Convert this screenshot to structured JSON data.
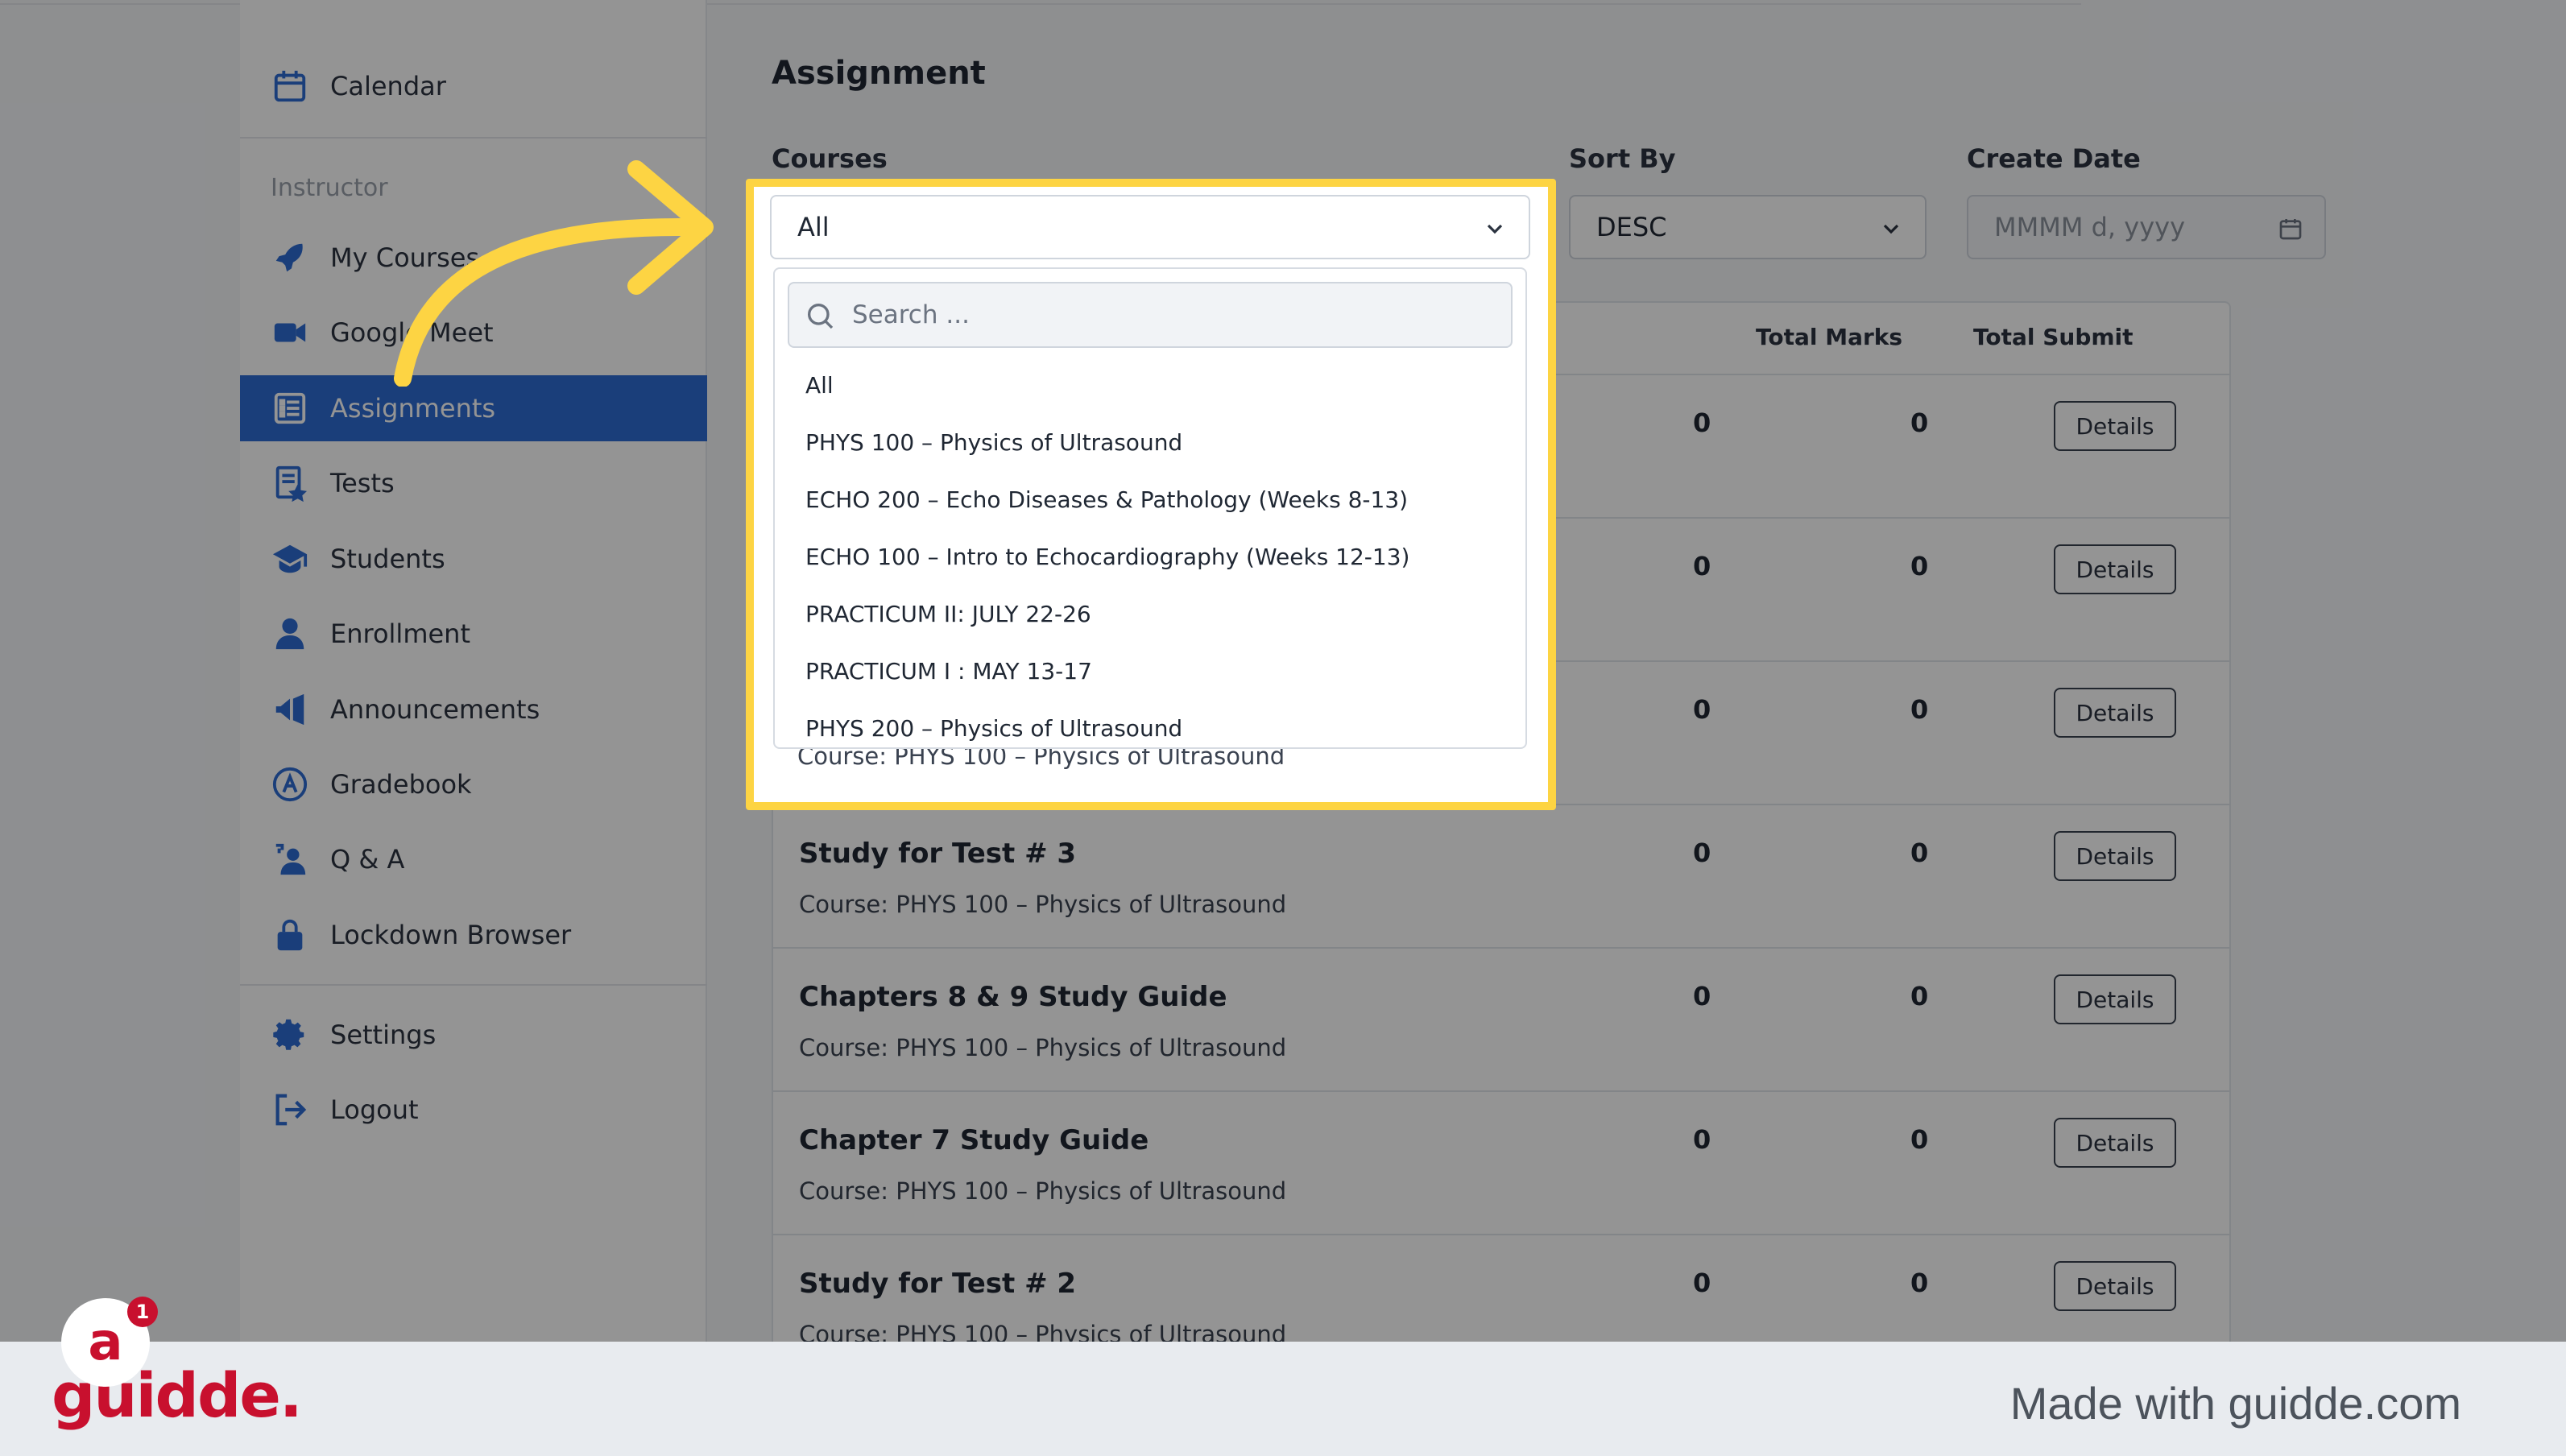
{
  "sidebar": {
    "top_items": [
      {
        "label": "Calendar",
        "icon": "calendar-icon"
      }
    ],
    "section_heading": "Instructor",
    "items": [
      {
        "label": "My Courses",
        "icon": "rocket-icon"
      },
      {
        "label": "Google Meet",
        "icon": "video-camera-icon"
      },
      {
        "label": "Assignments",
        "icon": "checklist-icon",
        "active": true
      },
      {
        "label": "Tests",
        "icon": "document-star-icon"
      },
      {
        "label": "Students",
        "icon": "graduation-cap-icon"
      },
      {
        "label": "Enrollment",
        "icon": "user-icon"
      },
      {
        "label": "Announcements",
        "icon": "megaphone-icon"
      },
      {
        "label": "Gradebook",
        "icon": "grade-icon"
      },
      {
        "label": "Q & A",
        "icon": "question-person-icon"
      },
      {
        "label": "Lockdown Browser",
        "icon": "lock-icon"
      }
    ],
    "bottom_items": [
      {
        "label": "Settings",
        "icon": "gear-icon"
      },
      {
        "label": "Logout",
        "icon": "logout-icon"
      }
    ]
  },
  "main": {
    "title": "Assignment",
    "filters": {
      "courses_label": "Courses",
      "courses_value": "All",
      "sort_label": "Sort By",
      "sort_value": "DESC",
      "date_label": "Create Date",
      "date_placeholder": "MMMM d, yyyy"
    },
    "dropdown": {
      "search_placeholder": "Search ...",
      "options": [
        "All",
        "PHYS 100 – Physics of Ultrasound",
        "ECHO 200 – Echo Diseases & Pathology (Weeks 8-13)",
        "ECHO 100 – Intro to Echocardiography (Weeks 12-13)",
        "PRACTICUM II: JULY 22-26",
        "PRACTICUM I : MAY 13-17",
        "PHYS 200 – Physics of Ultrasound"
      ]
    },
    "table": {
      "headers": {
        "total_marks": "Total Marks",
        "total_submit": "Total Submit"
      },
      "details_label": "Details",
      "peek_course": "Course: PHYS 100 – Physics of Ultrasound",
      "rows": [
        {
          "title": "",
          "course": "",
          "marks": "0",
          "submit": "0"
        },
        {
          "title": "",
          "course": "",
          "marks": "0",
          "submit": "0"
        },
        {
          "title": "",
          "course": "",
          "marks": "0",
          "submit": "0"
        },
        {
          "title": "Study for Test # 3",
          "course": "Course: PHYS 100 – Physics of Ultrasound",
          "marks": "0",
          "submit": "0"
        },
        {
          "title": "Chapters 8 & 9 Study Guide",
          "course": "Course: PHYS 100 – Physics of Ultrasound",
          "marks": "0",
          "submit": "0"
        },
        {
          "title": "Chapter 7 Study Guide",
          "course": "Course: PHYS 100 – Physics of Ultrasound",
          "marks": "0",
          "submit": "0"
        },
        {
          "title": "Study for Test # 2",
          "course": "Course: PHYS 100 – Physics of Ultrasound",
          "marks": "0",
          "submit": "0"
        }
      ]
    }
  },
  "footer": {
    "brand": "guidde.",
    "made_with": "Made with guidde.com",
    "avatar_letter": "a",
    "badge_count": "1"
  },
  "colors": {
    "accent": "#2d6cd3",
    "highlight": "#fdd443",
    "brand": "#c8102e"
  }
}
